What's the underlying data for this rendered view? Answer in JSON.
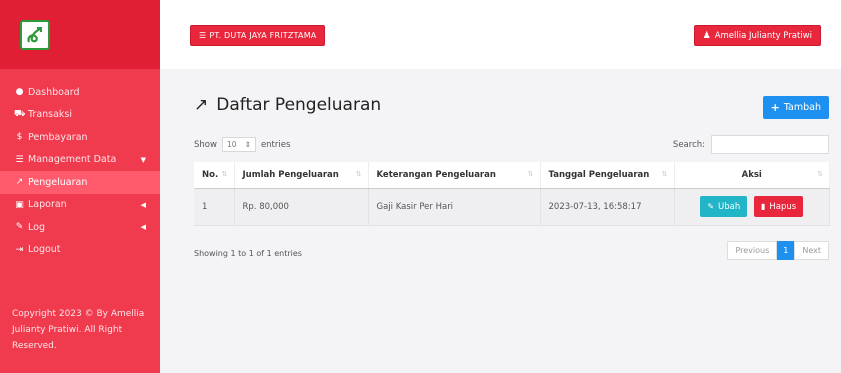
{
  "sidebar": {
    "items": [
      {
        "label": "Dashboard",
        "icon": "dashboard-icon",
        "glyph": "●",
        "caret": ""
      },
      {
        "label": "Transaksi",
        "icon": "truck-icon",
        "glyph": "⛟",
        "caret": ""
      },
      {
        "label": "Pembayaran",
        "icon": "dollar-icon",
        "glyph": "$",
        "caret": ""
      },
      {
        "label": "Management Data",
        "icon": "list-icon",
        "glyph": "☰",
        "caret": "▼"
      },
      {
        "label": "Pengeluaran",
        "icon": "share-icon",
        "glyph": "↗",
        "caret": ""
      },
      {
        "label": "Laporan",
        "icon": "report-icon",
        "glyph": "▣",
        "caret": "◀"
      },
      {
        "label": "Log",
        "icon": "log-icon",
        "glyph": "✎",
        "caret": "◀"
      },
      {
        "label": "Logout",
        "icon": "logout-icon",
        "glyph": "⇥",
        "caret": ""
      }
    ],
    "active_index": 4,
    "copyright": "Copyright 2023 © By Amellia Julianty Pratiwi. All Right Reserved."
  },
  "topbar": {
    "company": "PT. DUTA JAYA FRITZTAMA",
    "company_icon": "☰",
    "user": "Amellia Julianty Pratiwi",
    "user_icon": "♟"
  },
  "main": {
    "title": "Daftar Pengeluaran",
    "title_icon": "↗",
    "add_label": "Tambah",
    "add_icon": "+",
    "show_label": "Show",
    "entries_value": "10",
    "entries_label": "entries",
    "search_label": "Search:",
    "search_value": "",
    "columns": [
      "No.",
      "Jumlah Pengeluaran",
      "Keterangan Pengeluaran",
      "Tanggal Pengeluaran",
      "Aksi"
    ],
    "rows": [
      {
        "no": "1",
        "jumlah": "Rp. 80,000",
        "keterangan": "Gaji Kasir Per Hari",
        "tanggal": "2023-07-13, 16:58:17"
      }
    ],
    "edit_label": "Ubah",
    "delete_label": "Hapus",
    "info": "Showing 1 to 1 of 1 entries",
    "pager": {
      "previous": "Previous",
      "current": "1",
      "next": "Next"
    }
  },
  "colors": {
    "sidebar": "#f03a4e",
    "accent_red": "#e8273d",
    "primary_blue": "#1e90ef",
    "info_cyan": "#22b5c8"
  }
}
